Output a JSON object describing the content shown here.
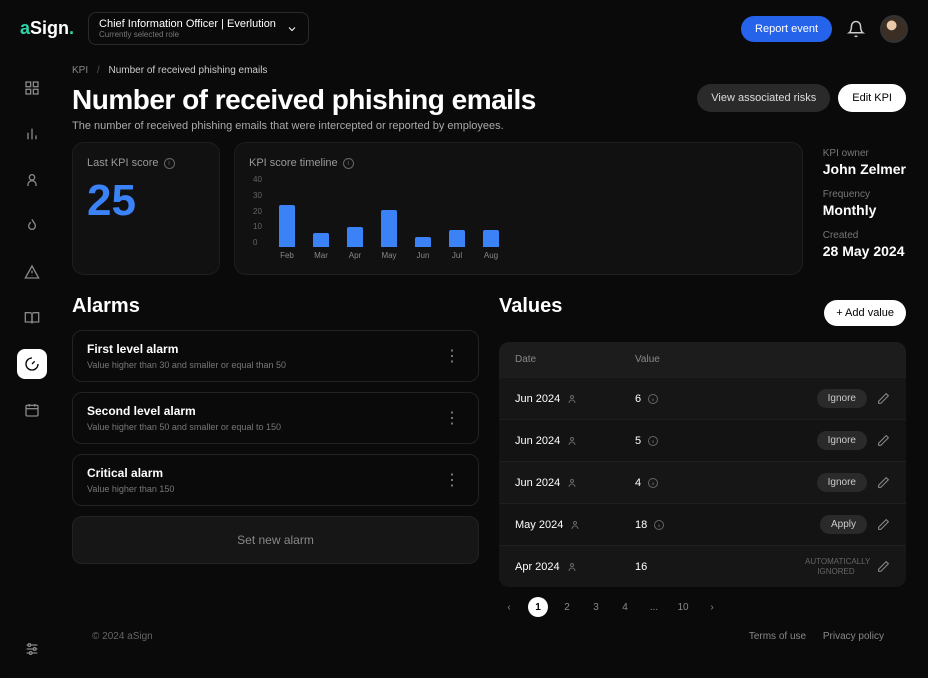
{
  "brand": {
    "a": "a",
    "sign": "Sign",
    "dot": "."
  },
  "role": {
    "main": "Chief Information Officer | Everlution",
    "sub": "Currently selected role"
  },
  "topbar": {
    "report": "Report event"
  },
  "breadcrumb": {
    "root": "KPI",
    "current": "Number of received phishing emails"
  },
  "hero": {
    "title": "Number of received phishing emails",
    "subtitle": "The number of received phishing emails that were intercepted or reported by employees.",
    "view_risks": "View associated risks",
    "edit": "Edit KPI"
  },
  "last_score": {
    "label": "Last KPI score",
    "value": "25"
  },
  "timeline": {
    "label": "KPI score timeline"
  },
  "chart_data": {
    "type": "bar",
    "categories": [
      "Feb",
      "Mar",
      "Apr",
      "May",
      "Jun",
      "Jul",
      "Aug"
    ],
    "values": [
      25,
      8,
      12,
      22,
      6,
      10,
      10
    ],
    "y_ticks": [
      "40",
      "30",
      "20",
      "10",
      "0"
    ],
    "ylim": [
      0,
      40
    ]
  },
  "meta": {
    "owner_lbl": "KPI owner",
    "owner": "John Zelmer",
    "freq_lbl": "Frequency",
    "freq": "Monthly",
    "created_lbl": "Created",
    "created": "28 May 2024"
  },
  "alarms": {
    "title": "Alarms",
    "items": [
      {
        "title": "First level alarm",
        "desc": "Value higher than 30 and smaller or equal than 50"
      },
      {
        "title": "Second level alarm",
        "desc": "Value higher than 50 and smaller or equal to 150"
      },
      {
        "title": "Critical alarm",
        "desc": "Value higher than 150"
      }
    ],
    "set_new": "Set new alarm"
  },
  "values": {
    "title": "Values",
    "add": "+ Add value",
    "head_date": "Date",
    "head_value": "Value",
    "rows": [
      {
        "date": "Jun 2024",
        "value": "6",
        "action": "Ignore",
        "info": true
      },
      {
        "date": "Jun 2024",
        "value": "5",
        "action": "Ignore",
        "info": true
      },
      {
        "date": "Jun 2024",
        "value": "4",
        "action": "Ignore",
        "info": true
      },
      {
        "date": "May 2024",
        "value": "18",
        "action": "Apply",
        "info": true
      },
      {
        "date": "Apr 2024",
        "value": "16",
        "action": "",
        "auto": "AUTOMATICALLY IGNORED"
      }
    ]
  },
  "pager": {
    "pages": [
      "1",
      "2",
      "3",
      "4",
      "...",
      "10"
    ]
  },
  "footer": {
    "copy": "© 2024 aSign",
    "terms": "Terms of use",
    "privacy": "Privacy policy"
  }
}
